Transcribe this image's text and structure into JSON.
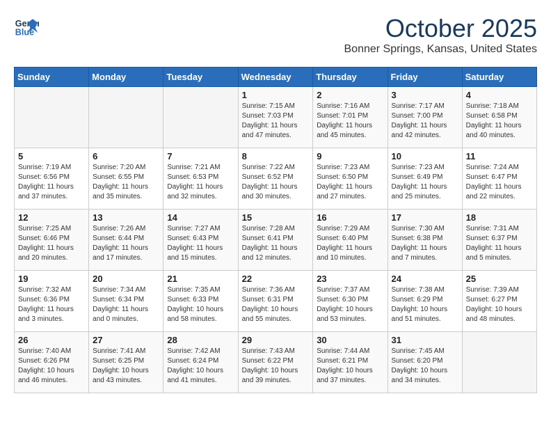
{
  "header": {
    "logo_line1": "General",
    "logo_line2": "Blue",
    "month": "October 2025",
    "location": "Bonner Springs, Kansas, United States"
  },
  "weekdays": [
    "Sunday",
    "Monday",
    "Tuesday",
    "Wednesday",
    "Thursday",
    "Friday",
    "Saturday"
  ],
  "weeks": [
    [
      {
        "day": "",
        "info": ""
      },
      {
        "day": "",
        "info": ""
      },
      {
        "day": "",
        "info": ""
      },
      {
        "day": "1",
        "info": "Sunrise: 7:15 AM\nSunset: 7:03 PM\nDaylight: 11 hours\nand 47 minutes."
      },
      {
        "day": "2",
        "info": "Sunrise: 7:16 AM\nSunset: 7:01 PM\nDaylight: 11 hours\nand 45 minutes."
      },
      {
        "day": "3",
        "info": "Sunrise: 7:17 AM\nSunset: 7:00 PM\nDaylight: 11 hours\nand 42 minutes."
      },
      {
        "day": "4",
        "info": "Sunrise: 7:18 AM\nSunset: 6:58 PM\nDaylight: 11 hours\nand 40 minutes."
      }
    ],
    [
      {
        "day": "5",
        "info": "Sunrise: 7:19 AM\nSunset: 6:56 PM\nDaylight: 11 hours\nand 37 minutes."
      },
      {
        "day": "6",
        "info": "Sunrise: 7:20 AM\nSunset: 6:55 PM\nDaylight: 11 hours\nand 35 minutes."
      },
      {
        "day": "7",
        "info": "Sunrise: 7:21 AM\nSunset: 6:53 PM\nDaylight: 11 hours\nand 32 minutes."
      },
      {
        "day": "8",
        "info": "Sunrise: 7:22 AM\nSunset: 6:52 PM\nDaylight: 11 hours\nand 30 minutes."
      },
      {
        "day": "9",
        "info": "Sunrise: 7:23 AM\nSunset: 6:50 PM\nDaylight: 11 hours\nand 27 minutes."
      },
      {
        "day": "10",
        "info": "Sunrise: 7:23 AM\nSunset: 6:49 PM\nDaylight: 11 hours\nand 25 minutes."
      },
      {
        "day": "11",
        "info": "Sunrise: 7:24 AM\nSunset: 6:47 PM\nDaylight: 11 hours\nand 22 minutes."
      }
    ],
    [
      {
        "day": "12",
        "info": "Sunrise: 7:25 AM\nSunset: 6:46 PM\nDaylight: 11 hours\nand 20 minutes."
      },
      {
        "day": "13",
        "info": "Sunrise: 7:26 AM\nSunset: 6:44 PM\nDaylight: 11 hours\nand 17 minutes."
      },
      {
        "day": "14",
        "info": "Sunrise: 7:27 AM\nSunset: 6:43 PM\nDaylight: 11 hours\nand 15 minutes."
      },
      {
        "day": "15",
        "info": "Sunrise: 7:28 AM\nSunset: 6:41 PM\nDaylight: 11 hours\nand 12 minutes."
      },
      {
        "day": "16",
        "info": "Sunrise: 7:29 AM\nSunset: 6:40 PM\nDaylight: 11 hours\nand 10 minutes."
      },
      {
        "day": "17",
        "info": "Sunrise: 7:30 AM\nSunset: 6:38 PM\nDaylight: 11 hours\nand 7 minutes."
      },
      {
        "day": "18",
        "info": "Sunrise: 7:31 AM\nSunset: 6:37 PM\nDaylight: 11 hours\nand 5 minutes."
      }
    ],
    [
      {
        "day": "19",
        "info": "Sunrise: 7:32 AM\nSunset: 6:36 PM\nDaylight: 11 hours\nand 3 minutes."
      },
      {
        "day": "20",
        "info": "Sunrise: 7:34 AM\nSunset: 6:34 PM\nDaylight: 11 hours\nand 0 minutes."
      },
      {
        "day": "21",
        "info": "Sunrise: 7:35 AM\nSunset: 6:33 PM\nDaylight: 10 hours\nand 58 minutes."
      },
      {
        "day": "22",
        "info": "Sunrise: 7:36 AM\nSunset: 6:31 PM\nDaylight: 10 hours\nand 55 minutes."
      },
      {
        "day": "23",
        "info": "Sunrise: 7:37 AM\nSunset: 6:30 PM\nDaylight: 10 hours\nand 53 minutes."
      },
      {
        "day": "24",
        "info": "Sunrise: 7:38 AM\nSunset: 6:29 PM\nDaylight: 10 hours\nand 51 minutes."
      },
      {
        "day": "25",
        "info": "Sunrise: 7:39 AM\nSunset: 6:27 PM\nDaylight: 10 hours\nand 48 minutes."
      }
    ],
    [
      {
        "day": "26",
        "info": "Sunrise: 7:40 AM\nSunset: 6:26 PM\nDaylight: 10 hours\nand 46 minutes."
      },
      {
        "day": "27",
        "info": "Sunrise: 7:41 AM\nSunset: 6:25 PM\nDaylight: 10 hours\nand 43 minutes."
      },
      {
        "day": "28",
        "info": "Sunrise: 7:42 AM\nSunset: 6:24 PM\nDaylight: 10 hours\nand 41 minutes."
      },
      {
        "day": "29",
        "info": "Sunrise: 7:43 AM\nSunset: 6:22 PM\nDaylight: 10 hours\nand 39 minutes."
      },
      {
        "day": "30",
        "info": "Sunrise: 7:44 AM\nSunset: 6:21 PM\nDaylight: 10 hours\nand 37 minutes."
      },
      {
        "day": "31",
        "info": "Sunrise: 7:45 AM\nSunset: 6:20 PM\nDaylight: 10 hours\nand 34 minutes."
      },
      {
        "day": "",
        "info": ""
      }
    ]
  ]
}
